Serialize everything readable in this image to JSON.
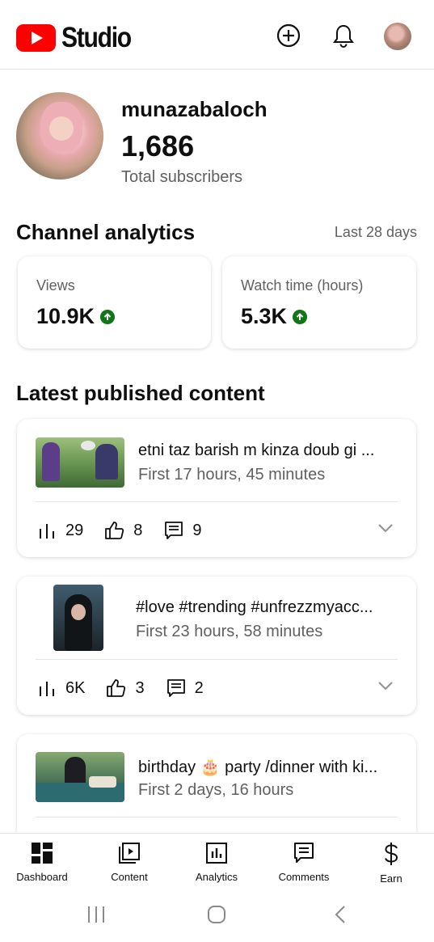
{
  "header": {
    "logo_text": "Studio",
    "brand_color": "#ff0000",
    "icons": [
      "create-icon",
      "notifications-icon",
      "account-avatar"
    ]
  },
  "channel": {
    "name": "munazabaloch",
    "subscriber_count": "1,686",
    "subscriber_label": "Total subscribers"
  },
  "analytics": {
    "title": "Channel analytics",
    "range": "Last 28 days",
    "stats": [
      {
        "label": "Views",
        "value": "10.9K",
        "trend": "up"
      },
      {
        "label": "Watch time (hours)",
        "value": "5.3K",
        "trend": "up"
      }
    ],
    "trend_color": "#107516"
  },
  "latest": {
    "title": "Latest published content",
    "videos": [
      {
        "title": "etni taz barish m kinza doub gi ...",
        "subtitle": "First 17 hours, 45 minutes",
        "views": "29",
        "likes": "8",
        "comments": "9",
        "thumb_shape": "landscape"
      },
      {
        "title": "#love #trending #unfrezzmyacc...",
        "subtitle": "First 23 hours, 58 minutes",
        "views": "6K",
        "likes": "3",
        "comments": "2",
        "thumb_shape": "portrait"
      },
      {
        "title": "birthday 🎂 party /dinner with ki...",
        "subtitle": "First 2 days, 16 hours",
        "thumb_shape": "landscape"
      }
    ]
  },
  "nav": {
    "items": [
      {
        "label": "Dashboard",
        "icon": "dashboard-icon",
        "active": true
      },
      {
        "label": "Content",
        "icon": "content-icon"
      },
      {
        "label": "Analytics",
        "icon": "analytics-icon"
      },
      {
        "label": "Comments",
        "icon": "comments-icon"
      },
      {
        "label": "Earn",
        "icon": "earn-icon"
      }
    ]
  },
  "system_nav": [
    "recents-button",
    "home-button",
    "back-button"
  ]
}
